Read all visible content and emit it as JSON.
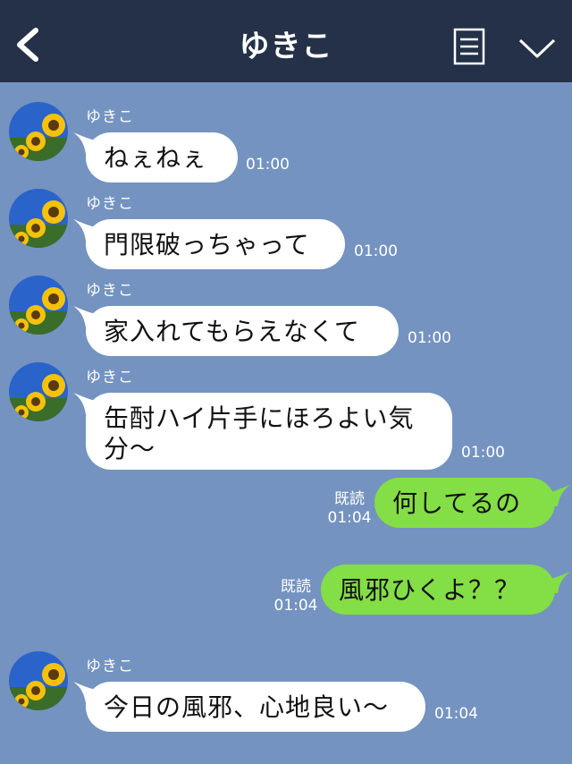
{
  "header": {
    "title": "ゆきこ",
    "back_icon": "chevron-left-icon",
    "menu_icon": "list-icon",
    "collapse_icon": "chevron-down-icon"
  },
  "colors": {
    "header_bg": "#243148",
    "chat_bg": "#7493c0",
    "incoming_bubble": "#ffffff",
    "outgoing_bubble": "#84de45"
  },
  "messages": [
    {
      "direction": "in",
      "sender": "ゆきこ",
      "lines": [
        "ねぇねぇ"
      ],
      "time": "01:00"
    },
    {
      "direction": "in",
      "sender": "ゆきこ",
      "lines": [
        "門限破っちゃって"
      ],
      "time": "01:00"
    },
    {
      "direction": "in",
      "sender": "ゆきこ",
      "lines": [
        "家入れてもらえなくて"
      ],
      "time": "01:00"
    },
    {
      "direction": "in",
      "sender": "ゆきこ",
      "lines": [
        "缶酎ハイ片手にほろよい気",
        "分〜"
      ],
      "time": "01:00"
    },
    {
      "direction": "out",
      "lines": [
        "何してるの"
      ],
      "read": "既読",
      "time": "01:04"
    },
    {
      "direction": "out",
      "lines": [
        "風邪ひくよ？？"
      ],
      "read": "既読",
      "time": "01:04"
    },
    {
      "direction": "in",
      "sender": "ゆきこ",
      "lines": [
        "今日の風邪、心地良い〜"
      ],
      "time": "01:04"
    }
  ]
}
